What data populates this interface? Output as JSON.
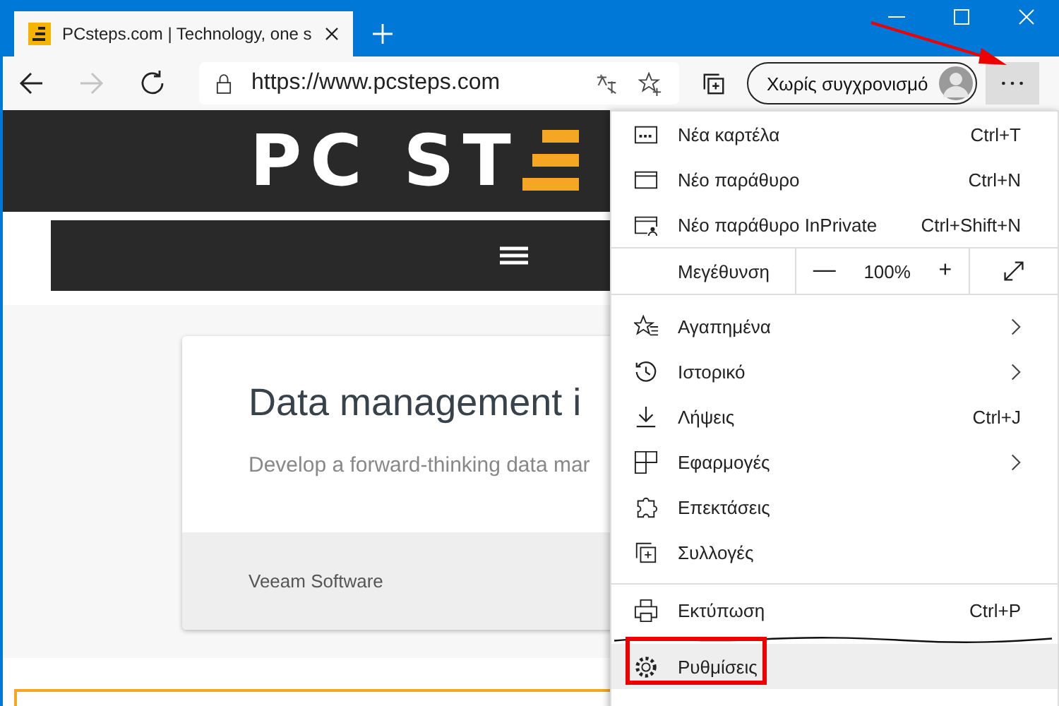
{
  "tab": {
    "title": "PCsteps.com | Technology, one s",
    "selected": true
  },
  "toolbar": {
    "nav": [
      {
        "disabled": false
      },
      {
        "disabled": true
      }
    ],
    "address": "https://www.pcsteps.com",
    "profile": "Χωρίς συγχρονισμό"
  },
  "page": {
    "logo": "PC ST",
    "card": {
      "title": "Data management i",
      "text": "Develop a forward-thinking data mar",
      "source": "Veeam Software"
    }
  },
  "menu": {
    "top_items": [
      {
        "label": "Νέα καρτέλα",
        "shortcut": "Ctrl+T"
      },
      {
        "label": "Νέο παράθυρο",
        "shortcut": "Ctrl+N"
      },
      {
        "label": "Νέο παράθυρο InPrivate",
        "shortcut": "Ctrl+Shift+N"
      }
    ],
    "zoom": {
      "label": "Μεγέθυνση",
      "minus": "—",
      "value": "100%",
      "plus": "+"
    },
    "items": [
      {
        "label": "Αγαπημένα",
        "submenu": true
      },
      {
        "label": "Ιστορικό",
        "submenu": true
      },
      {
        "label": "Λήψεις",
        "shortcut": "Ctrl+J",
        "submenu": false
      },
      {
        "label": "Εφαρμογές",
        "submenu": true
      },
      {
        "label": "Επεκτάσεις",
        "submenu": false
      },
      {
        "label": "Συλλογές",
        "submenu": false
      }
    ],
    "print": {
      "label": "Εκτύπωση",
      "shortcut": "Ctrl+P"
    },
    "settings": {
      "label": "Ρυθμίσεις",
      "highlighted": true
    }
  }
}
